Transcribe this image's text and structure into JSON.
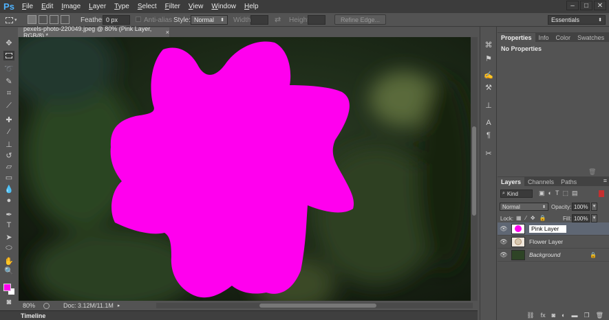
{
  "menubar": {
    "logo": "Ps",
    "items": [
      "File",
      "Edit",
      "Image",
      "Layer",
      "Type",
      "Select",
      "Filter",
      "View",
      "Window",
      "Help"
    ],
    "window_controls": [
      "–",
      "□",
      "✕"
    ]
  },
  "options": {
    "feather_label": "Feather:",
    "feather_value": "0 px",
    "antialias_label": "Anti-alias",
    "style_label": "Style:",
    "style_value": "Normal",
    "width_label": "Width:",
    "height_label": "Height:",
    "refine_edge": "Refine Edge...",
    "workspace": "Essentials"
  },
  "document": {
    "tab_title": "pexels-photo-220049.jpeg @ 80% (Pink Layer, RGB/8) *",
    "close": "×",
    "flower_color": "#ff00ee"
  },
  "status": {
    "zoom": "80%",
    "doc_size": "Doc: 3.12M/11.1M"
  },
  "timeline": {
    "label": "Timeline"
  },
  "properties_panel": {
    "tabs": [
      "Properties",
      "Info",
      "Color",
      "Swatches"
    ],
    "active_tab": "Properties",
    "message": "No Properties"
  },
  "layers_panel": {
    "tabs": [
      "Layers",
      "Channels",
      "Paths"
    ],
    "kind_label": "Kind",
    "blend_mode": "Normal",
    "opacity_label": "Opacity:",
    "opacity_value": "100%",
    "lock_label": "Lock:",
    "fill_label": "Fill:",
    "fill_value": "100%",
    "layers": [
      {
        "name": "Pink Layer",
        "selected": true,
        "thumb_color": "#ff00ee"
      },
      {
        "name": "Flower Layer",
        "selected": false,
        "thumb_color": "#d8c8b0"
      },
      {
        "name": "Background",
        "selected": false,
        "thumb_color": "#2e4426",
        "locked": true
      }
    ],
    "footer_icons": [
      "link-icon",
      "fx-icon",
      "mask-icon",
      "adjustment-icon",
      "folder-icon",
      "new-layer-icon",
      "trash-icon"
    ]
  }
}
